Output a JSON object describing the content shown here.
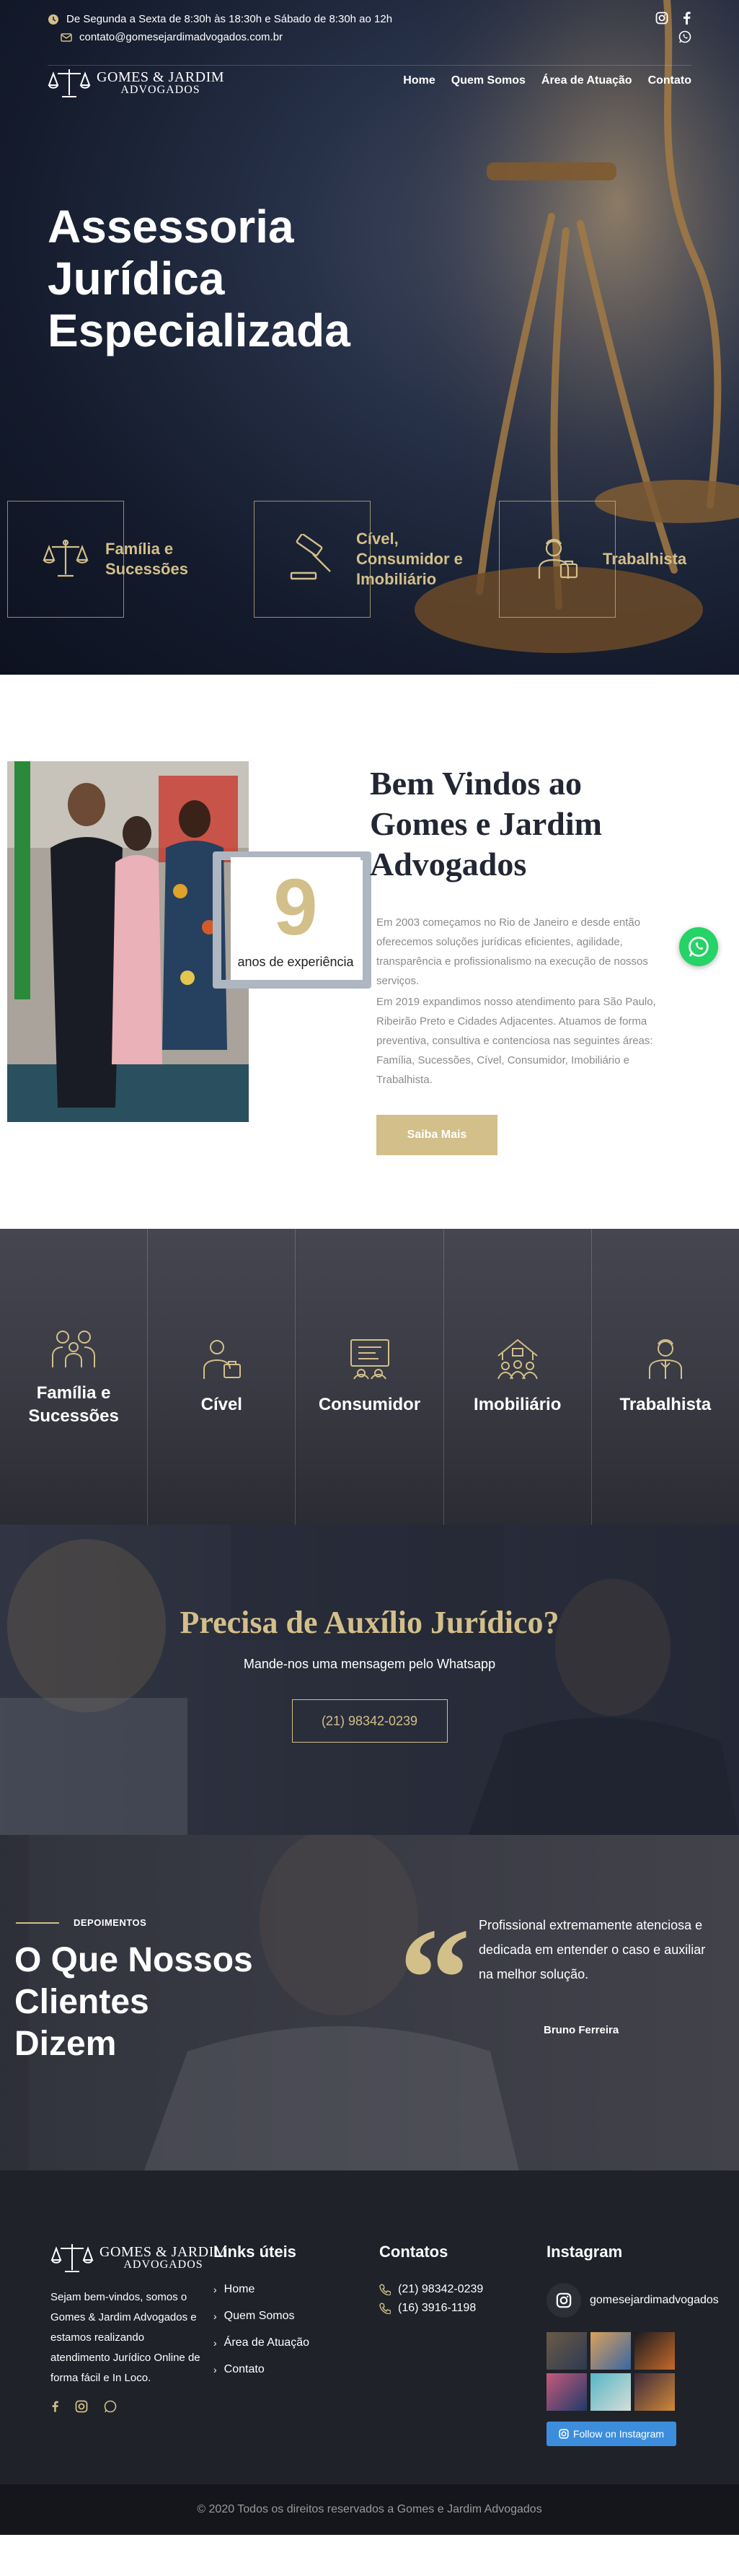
{
  "topbar": {
    "hours": "De Segunda a Sexta de 8:30h às 18:30h e Sábado de 8:30h ao 12h",
    "email": "contato@gomesejardimadvogados.com.br"
  },
  "brand": {
    "line1": "GOMES & JARDIM",
    "line2": "ADVOGADOS"
  },
  "nav": [
    "Home",
    "Quem Somos",
    "Área de Atuação",
    "Contato"
  ],
  "hero": {
    "title_lines": [
      "Assessoria",
      "Jurídica",
      "Especializada"
    ],
    "cards": [
      {
        "label_l1": "Família e",
        "label_l2": "Sucessões",
        "label_l3": "",
        "icon": "scales-icon"
      },
      {
        "label_l1": "Cível,",
        "label_l2": "Consumidor e",
        "label_l3": "Imobiliário",
        "icon": "gavel-icon"
      },
      {
        "label_l1": "Trabalhista",
        "label_l2": "",
        "label_l3": "",
        "icon": "worker-icon"
      }
    ]
  },
  "welcome": {
    "title_lines": [
      "Bem Vindos ao",
      "Gomes e Jardim",
      "Advogados"
    ],
    "years": "9",
    "years_label": "anos de experiência",
    "p1": "Em 2003 começamos no Rio de Janeiro e desde então oferecemos soluções jurídicas eficientes, agilidade, transparência e profissionalismo na execução de nossos serviços.",
    "p2": "Em 2019 expandimos nosso atendimento para São Paulo, Ribeirão Preto e Cidades Adjacentes. Atuamos de forma preventiva, consultiva e contenciosa nas seguintes áreas: Família, Sucessões, Cível, Consumidor, Imobiliário e Trabalhista.",
    "button": "Saiba Mais"
  },
  "areas": [
    {
      "l1": "Família e",
      "l2": "Sucessões",
      "icon": "family-icon"
    },
    {
      "l1": "Cível",
      "l2": "",
      "icon": "civil-icon"
    },
    {
      "l1": "Consumidor",
      "l2": "",
      "icon": "consumer-icon"
    },
    {
      "l1": "Imobiliário",
      "l2": "",
      "icon": "real-estate-icon"
    },
    {
      "l1": "Trabalhista",
      "l2": "",
      "icon": "worker-icon"
    }
  ],
  "cta": {
    "title": "Precisa de Auxílio Jurídico?",
    "subtitle": "Mande-nos uma mensagem pelo Whatsapp",
    "phone": "(21) 98342-0239"
  },
  "testimonials": {
    "kicker": "DEPOIMENTOS",
    "title_lines": [
      "O Que Nossos",
      "Clientes",
      "Dizem"
    ],
    "quote": "Profissional extremamente atenciosa e dedicada em entender o caso e auxiliar na melhor solução.",
    "author": "Bruno Ferreira"
  },
  "footer": {
    "about": "Sejam bem-vindos, somos o Gomes & Jardim Advogados e estamos realizando atendimento Jurídico Online de forma fácil e In Loco.",
    "links_title": "Links úteis",
    "links": [
      "Home",
      "Quem Somos",
      "Área de Atuação",
      "Contato"
    ],
    "contacts_title": "Contatos",
    "phones": [
      "(21) 98342-0239",
      "(16) 3916-1198"
    ],
    "instagram_title": "Instagram",
    "instagram_handle": "gomesejardimadvogados",
    "follow_label": "Follow on Instagram",
    "copyright": "© 2020 Todos os direitos reservados a Gomes e Jardim Advogados"
  },
  "colors": {
    "gold": "#d3bf89",
    "dark": "#1f2229",
    "whatsapp": "#25d366"
  }
}
